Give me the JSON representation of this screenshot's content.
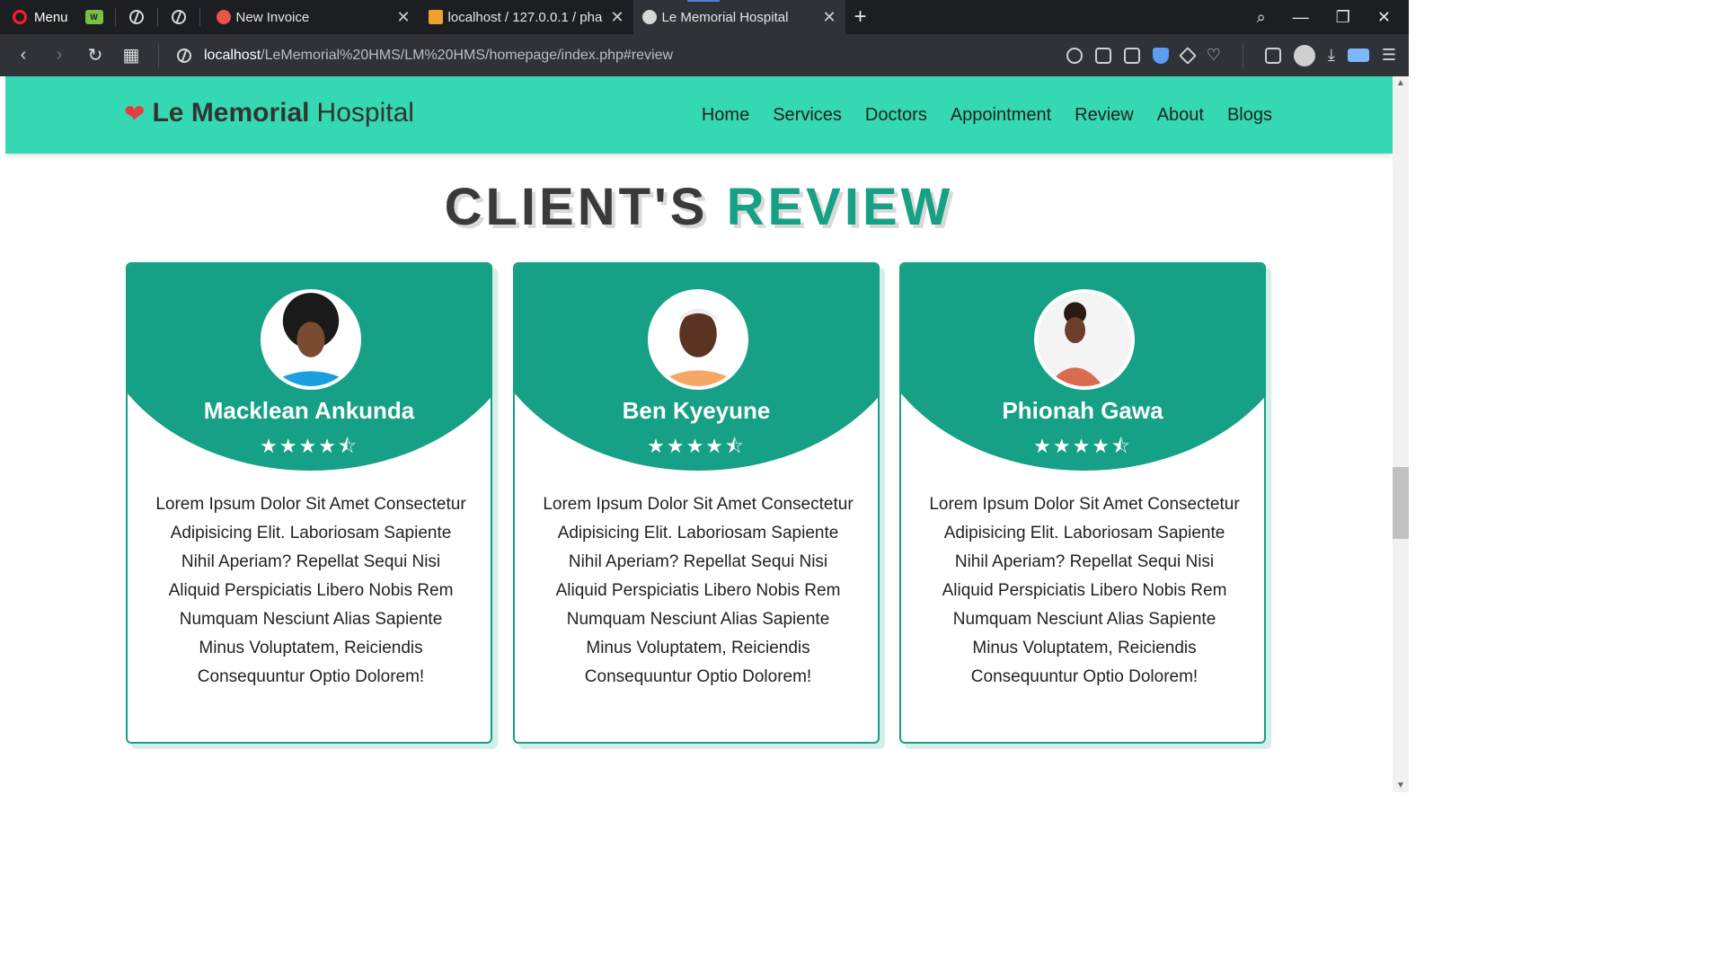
{
  "browser": {
    "menu_label": "Menu",
    "tabs": [
      {
        "title": "New Invoice",
        "active": false
      },
      {
        "title": "localhost / 127.0.0.1 / phar",
        "active": false
      },
      {
        "title": "Le Memorial Hospital",
        "active": true
      }
    ],
    "url_host": "localhost",
    "url_path": "/LeMemorial%20HMS/LM%20HMS/homepage/index.php#review"
  },
  "site": {
    "logo_bold": "Le Memorial",
    "logo_regular": "Hospital",
    "nav": [
      "Home",
      "Services",
      "Doctors",
      "Appointment",
      "Review",
      "About",
      "Blogs"
    ]
  },
  "section": {
    "title_part1": "CLIENT'S",
    "title_part2": "REVIEW"
  },
  "reviews": [
    {
      "name": "Macklean Ankunda",
      "rating": 4.5,
      "text": "Lorem Ipsum Dolor Sit Amet Consectetur Adipisicing Elit. Laboriosam Sapiente Nihil Aperiam? Repellat Sequi Nisi Aliquid Perspiciatis Libero Nobis Rem Numquam Nesciunt Alias Sapiente Minus Voluptatem, Reiciendis Consequuntur Optio Dolorem!"
    },
    {
      "name": "Ben Kyeyune",
      "rating": 4.5,
      "text": "Lorem Ipsum Dolor Sit Amet Consectetur Adipisicing Elit. Laboriosam Sapiente Nihil Aperiam? Repellat Sequi Nisi Aliquid Perspiciatis Libero Nobis Rem Numquam Nesciunt Alias Sapiente Minus Voluptatem, Reiciendis Consequuntur Optio Dolorem!"
    },
    {
      "name": "Phionah Gawa",
      "rating": 4.5,
      "text": "Lorem Ipsum Dolor Sit Amet Consectetur Adipisicing Elit. Laboriosam Sapiente Nihil Aperiam? Repellat Sequi Nisi Aliquid Perspiciatis Libero Nobis Rem Numquam Nesciunt Alias Sapiente Minus Voluptatem, Reiciendis Consequuntur Optio Dolorem!"
    }
  ],
  "colors": {
    "header_bg": "#34d9b3",
    "accent": "#16a085",
    "logo_heart": "#e43d3d"
  }
}
